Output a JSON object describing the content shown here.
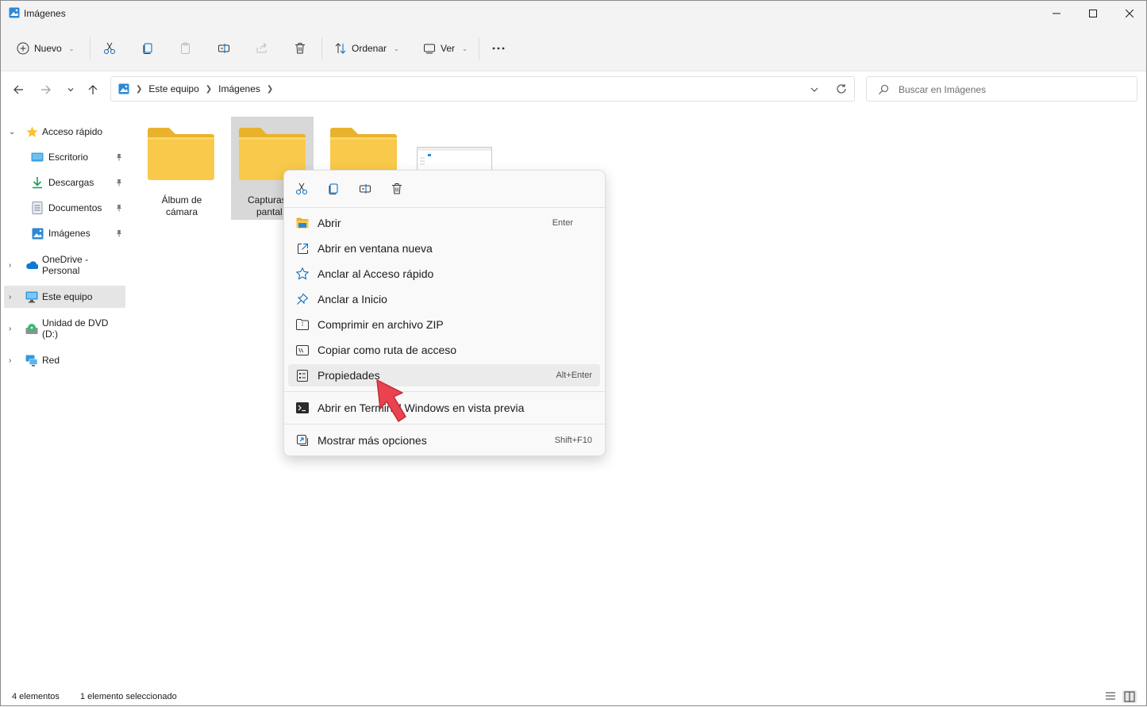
{
  "window": {
    "title": "Imágenes"
  },
  "toolbar": {
    "new_label": "Nuevo",
    "sort_label": "Ordenar",
    "view_label": "Ver"
  },
  "address": {
    "crumbs": [
      "Este equipo",
      "Imágenes"
    ]
  },
  "search": {
    "placeholder": "Buscar en Imágenes"
  },
  "sidebar": {
    "items": [
      {
        "label": "Acceso rápido",
        "icon": "star-icon"
      },
      {
        "label": "Escritorio",
        "icon": "desktop-icon"
      },
      {
        "label": "Descargas",
        "icon": "download-icon"
      },
      {
        "label": "Documentos",
        "icon": "document-icon"
      },
      {
        "label": "Imágenes",
        "icon": "pictures-icon"
      },
      {
        "label": "OneDrive - Personal",
        "icon": "onedrive-icon"
      },
      {
        "label": "Este equipo",
        "icon": "computer-icon"
      },
      {
        "label": "Unidad de DVD (D:)",
        "icon": "dvd-icon"
      },
      {
        "label": "Red",
        "icon": "network-icon"
      }
    ]
  },
  "files": [
    {
      "label_line1": "Álbum de",
      "label_line2": "cámara"
    },
    {
      "label_line1": "Capturas",
      "label_line2": "pantal"
    }
  ],
  "context_menu": {
    "items": [
      {
        "label": "Abrir",
        "shortcut": "Enter"
      },
      {
        "label": "Abrir en ventana nueva",
        "shortcut": ""
      },
      {
        "label": "Anclar al Acceso rápido",
        "shortcut": ""
      },
      {
        "label": "Anclar a Inicio",
        "shortcut": ""
      },
      {
        "label": "Comprimir en archivo ZIP",
        "shortcut": ""
      },
      {
        "label": "Copiar como ruta de acceso",
        "shortcut": ""
      },
      {
        "label": "Propiedades",
        "shortcut": "Alt+Enter"
      },
      {
        "label": "Abrir en Terminal Windows en vista previa",
        "shortcut": ""
      },
      {
        "label": "Mostrar más opciones",
        "shortcut": "Shift+F10"
      }
    ]
  },
  "status": {
    "count": "4 elementos",
    "selected": "1 elemento seleccionado"
  },
  "colors": {
    "folder": "#f8c94a",
    "folder_dark": "#eab22c",
    "accent": "#0067c0",
    "arrow": "#e8434f"
  }
}
